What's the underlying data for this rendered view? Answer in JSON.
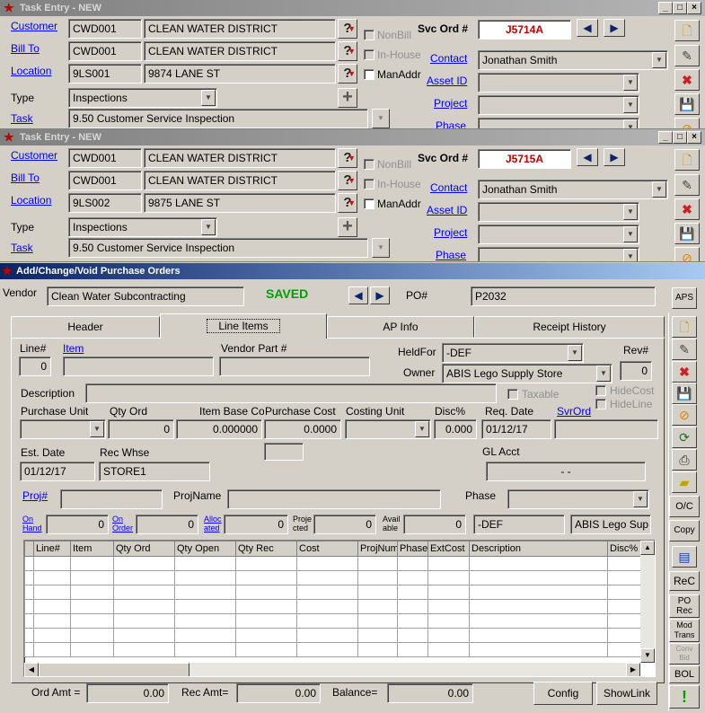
{
  "task1": {
    "title": "Task Entry - NEW",
    "labels": {
      "customer": "Customer",
      "bill_to": "Bill To",
      "location": "Location",
      "type": "Type",
      "task": "Task",
      "svc_ord": "Svc Ord #",
      "contact": "Contact",
      "asset_id": "Asset ID",
      "project": "Project",
      "phase": "Phase",
      "nonbill": "NonBill",
      "inhouse": "In-House",
      "manaddr": "ManAddr"
    },
    "customer_code": "CWD001",
    "customer_name": "CLEAN WATER DISTRICT",
    "billto_code": "CWD001",
    "billto_name": "CLEAN WATER DISTRICT",
    "location_code": "9LS001",
    "location_addr": "9874 LANE ST",
    "type": "Inspections",
    "task": "9.50 Customer Service Inspection",
    "svc_ord": "J5714A",
    "contact": "Jonathan Smith"
  },
  "task2": {
    "title": "Task Entry - NEW",
    "labels": {
      "customer": "Customer",
      "bill_to": "Bill To",
      "location": "Location",
      "type": "Type",
      "task": "Task",
      "svc_ord": "Svc Ord #",
      "contact": "Contact",
      "asset_id": "Asset ID",
      "project": "Project",
      "phase": "Phase",
      "nonbill": "NonBill",
      "inhouse": "In-House",
      "manaddr": "ManAddr"
    },
    "customer_code": "CWD001",
    "customer_name": "CLEAN WATER DISTRICT",
    "billto_code": "CWD001",
    "billto_name": "CLEAN WATER DISTRICT",
    "location_code": "9LS002",
    "location_addr": "9875 LANE ST",
    "type": "Inspections",
    "task": "9.50 Customer Service Inspection",
    "svc_ord": "J5715A",
    "contact": "Jonathan Smith"
  },
  "po": {
    "title": "Add/Change/Void Purchase Orders",
    "vendor_label": "Vendor",
    "vendor": "Clean Water Subcontracting",
    "status": "SAVED",
    "po_label": "PO#",
    "po_number": "P2032",
    "aps_label": "APS",
    "tabs": [
      "Header",
      "Line Items",
      "AP Info",
      "Receipt History"
    ],
    "labels": {
      "line_no": "Line#",
      "item": "Item",
      "vendor_part": "Vendor Part #",
      "heldfor": "HeldFor",
      "rev": "Rev#",
      "owner": "Owner",
      "description": "Description",
      "taxable": "Taxable",
      "hidecost": "HideCost",
      "hideline": "HideLine",
      "purchase_unit": "Purchase Unit",
      "qty_ord": "Qty Ord",
      "item_base": "Item Base Cost",
      "purchase_cost": "Purchase Cost",
      "costing_unit": "Costing Unit",
      "disc": "Disc%",
      "req_date": "Req. Date",
      "svrord": "SvrOrd",
      "est_date": "Est. Date",
      "rec_whse": "Rec Whse",
      "gl_acct": "GL Acct",
      "proj": "Proj#",
      "projname": "ProjName",
      "phase": "Phase",
      "on_hand": "On Hand",
      "on_order": "On Order",
      "allocated": "Alloc ated",
      "projected": "Proje cted",
      "available": "Avail able"
    },
    "values": {
      "line_no": "0",
      "heldfor": "-DEF",
      "rev": "0",
      "owner": "ABIS Lego Supply Store",
      "qty_ord": "0",
      "item_base": "0.000000",
      "purchase_cost": "0.0000",
      "disc": "0.000",
      "req_date": "01/12/17",
      "est_date": "01/12/17",
      "rec_whse": "STORE1",
      "gl_acct": "-  -",
      "on_hand": "0",
      "on_order": "0",
      "allocated": "0",
      "projected": "0",
      "available": "0",
      "heldfor2": "-DEF",
      "owner2": "ABIS Lego Sup"
    },
    "grid_columns": [
      "Line#",
      "Item",
      "Qty Ord",
      "Qty Open",
      "Qty Rec",
      "Cost",
      "ProjNum",
      "Phase",
      "ExtCost",
      "Description",
      "Disc%"
    ],
    "footer": {
      "ord_amt_label": "Ord Amt =",
      "ord_amt": "0.00",
      "rec_amt_label": "Rec Amt=",
      "rec_amt": "0.00",
      "balance_label": "Balance=",
      "balance": "0.00",
      "config": "Config",
      "showlink": "ShowLink"
    },
    "side_buttons": {
      "oc": "O/C",
      "copy": "Copy",
      "rec": "ReC",
      "po_rec": "PO Rec",
      "mod_trans": "Mod Trans",
      "conv_bid": "Conv Bid",
      "bol": "BOL"
    }
  },
  "colors": {
    "accent": "#0a246a",
    "saved": "#00a000",
    "svc": "#c00000"
  }
}
